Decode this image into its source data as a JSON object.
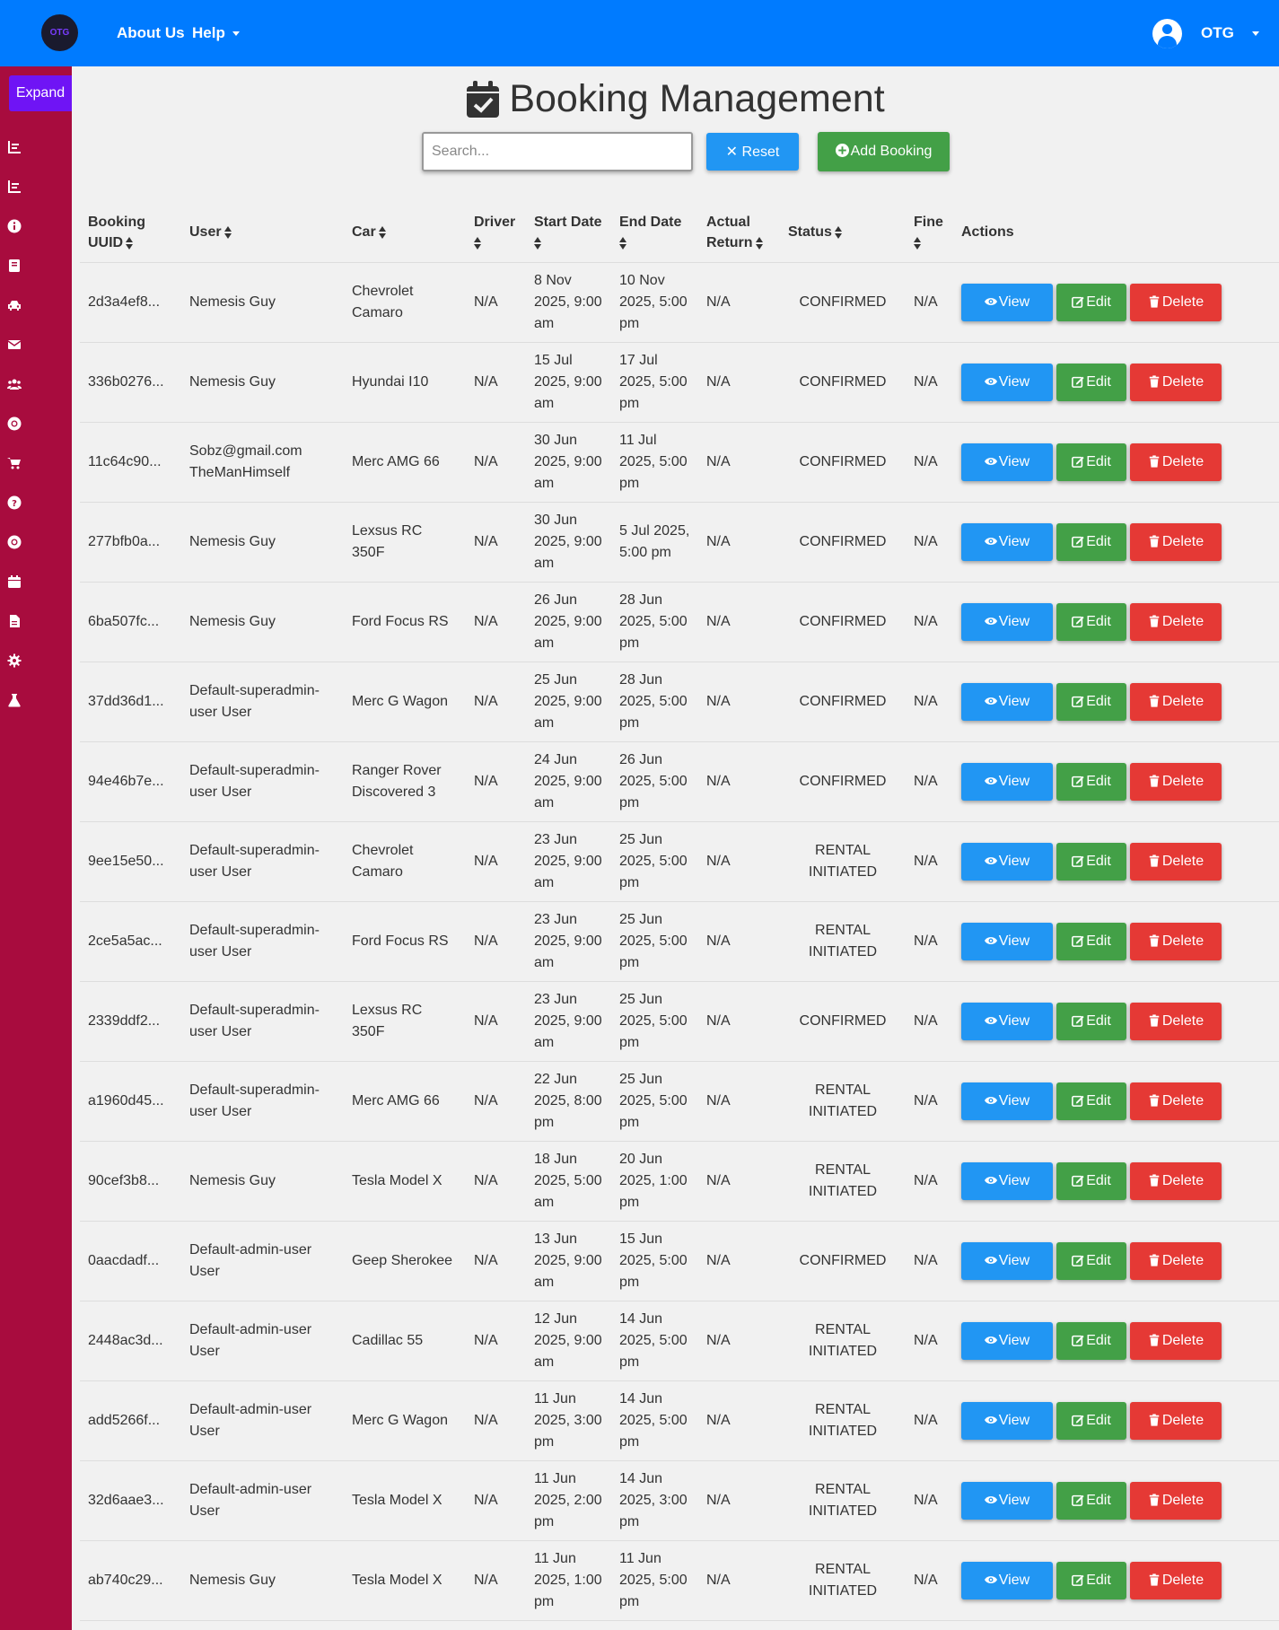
{
  "navbar": {
    "logo": "OTG",
    "about": "About Us",
    "help": "Help",
    "user": "OTG"
  },
  "sidebar": {
    "expand": "Expand",
    "icons": [
      "chart-bar-icon",
      "chart-bar-icon",
      "info-icon",
      "book-icon",
      "car-icon",
      "envelope-icon",
      "users-icon",
      "life-ring-icon",
      "cart-icon",
      "question-icon",
      "life-ring-icon",
      "calendar-icon",
      "file-icon",
      "gear-icon",
      "flask-icon"
    ]
  },
  "page": {
    "title": "Booking Management",
    "search_placeholder": "Search...",
    "reset": "✕ Reset",
    "add": "Add Booking"
  },
  "table": {
    "headers": {
      "uuid": "Booking UUID",
      "user": "User",
      "car": "Car",
      "driver": "Driver",
      "start": "Start Date",
      "end": "End Date",
      "actual": "Actual Return",
      "status": "Status",
      "fine": "Fine",
      "actions": "Actions"
    },
    "actions": {
      "view": "View",
      "edit": "Edit",
      "delete": "Delete"
    },
    "rows": [
      {
        "uuid": "2d3a4ef8...",
        "user": "Nemesis Guy",
        "car": "Chevrolet Camaro",
        "driver": "N/A",
        "start": "8 Nov 2025, 9:00 am",
        "end": "10 Nov 2025, 5:00 pm",
        "actual": "N/A",
        "status": "CONFIRMED",
        "fine": "N/A"
      },
      {
        "uuid": "336b0276...",
        "user": "Nemesis Guy",
        "car": "Hyundai I10",
        "driver": "N/A",
        "start": "15 Jul 2025, 9:00 am",
        "end": "17 Jul 2025, 5:00 pm",
        "actual": "N/A",
        "status": "CONFIRMED",
        "fine": "N/A"
      },
      {
        "uuid": "11c64c90...",
        "user": "Sobz@gmail.com TheManHimself",
        "car": "Merc AMG 66",
        "driver": "N/A",
        "start": "30 Jun 2025, 9:00 am",
        "end": "11 Jul 2025, 5:00 pm",
        "actual": "N/A",
        "status": "CONFIRMED",
        "fine": "N/A"
      },
      {
        "uuid": "277bfb0a...",
        "user": "Nemesis Guy",
        "car": "Lexsus RC 350F",
        "driver": "N/A",
        "start": "30 Jun 2025, 9:00 am",
        "end": "5 Jul 2025, 5:00 pm",
        "actual": "N/A",
        "status": "CONFIRMED",
        "fine": "N/A"
      },
      {
        "uuid": "6ba507fc...",
        "user": "Nemesis Guy",
        "car": "Ford Focus RS",
        "driver": "N/A",
        "start": "26 Jun 2025, 9:00 am",
        "end": "28 Jun 2025, 5:00 pm",
        "actual": "N/A",
        "status": "CONFIRMED",
        "fine": "N/A"
      },
      {
        "uuid": "37dd36d1...",
        "user": "Default-superadmin-user User",
        "car": "Merc G Wagon",
        "driver": "N/A",
        "start": "25 Jun 2025, 9:00 am",
        "end": "28 Jun 2025, 5:00 pm",
        "actual": "N/A",
        "status": "CONFIRMED",
        "fine": "N/A"
      },
      {
        "uuid": "94e46b7e...",
        "user": "Default-superadmin-user User",
        "car": "Ranger Rover Discovered 3",
        "driver": "N/A",
        "start": "24 Jun 2025, 9:00 am",
        "end": "26 Jun 2025, 5:00 pm",
        "actual": "N/A",
        "status": "CONFIRMED",
        "fine": "N/A"
      },
      {
        "uuid": "9ee15e50...",
        "user": "Default-superadmin-user User",
        "car": "Chevrolet Camaro",
        "driver": "N/A",
        "start": "23 Jun 2025, 9:00 am",
        "end": "25 Jun 2025, 5:00 pm",
        "actual": "N/A",
        "status": "RENTAL INITIATED",
        "fine": "N/A"
      },
      {
        "uuid": "2ce5a5ac...",
        "user": "Default-superadmin-user User",
        "car": "Ford Focus RS",
        "driver": "N/A",
        "start": "23 Jun 2025, 9:00 am",
        "end": "25 Jun 2025, 5:00 pm",
        "actual": "N/A",
        "status": "RENTAL INITIATED",
        "fine": "N/A"
      },
      {
        "uuid": "2339ddf2...",
        "user": "Default-superadmin-user User",
        "car": "Lexsus RC 350F",
        "driver": "N/A",
        "start": "23 Jun 2025, 9:00 am",
        "end": "25 Jun 2025, 5:00 pm",
        "actual": "N/A",
        "status": "CONFIRMED",
        "fine": "N/A"
      },
      {
        "uuid": "a1960d45...",
        "user": "Default-superadmin-user User",
        "car": "Merc AMG 66",
        "driver": "N/A",
        "start": "22 Jun 2025, 8:00 pm",
        "end": "25 Jun 2025, 5:00 pm",
        "actual": "N/A",
        "status": "RENTAL INITIATED",
        "fine": "N/A"
      },
      {
        "uuid": "90cef3b8...",
        "user": "Nemesis Guy",
        "car": "Tesla Model X",
        "driver": "N/A",
        "start": "18 Jun 2025, 5:00 am",
        "end": "20 Jun 2025, 1:00 pm",
        "actual": "N/A",
        "status": "RENTAL INITIATED",
        "fine": "N/A"
      },
      {
        "uuid": "0aacdadf...",
        "user": "Default-admin-user User",
        "car": "Geep Sherokee",
        "driver": "N/A",
        "start": "13 Jun 2025, 9:00 am",
        "end": "15 Jun 2025, 5:00 pm",
        "actual": "N/A",
        "status": "CONFIRMED",
        "fine": "N/A"
      },
      {
        "uuid": "2448ac3d...",
        "user": "Default-admin-user User",
        "car": "Cadillac 55",
        "driver": "N/A",
        "start": "12 Jun 2025, 9:00 am",
        "end": "14 Jun 2025, 5:00 pm",
        "actual": "N/A",
        "status": "RENTAL INITIATED",
        "fine": "N/A"
      },
      {
        "uuid": "add5266f...",
        "user": "Default-admin-user User",
        "car": "Merc G Wagon",
        "driver": "N/A",
        "start": "11 Jun 2025, 3:00 pm",
        "end": "14 Jun 2025, 5:00 pm",
        "actual": "N/A",
        "status": "RENTAL INITIATED",
        "fine": "N/A"
      },
      {
        "uuid": "32d6aae3...",
        "user": "Default-admin-user User",
        "car": "Tesla Model X",
        "driver": "N/A",
        "start": "11 Jun 2025, 2:00 pm",
        "end": "14 Jun 2025, 3:00 pm",
        "actual": "N/A",
        "status": "RENTAL INITIATED",
        "fine": "N/A"
      },
      {
        "uuid": "ab740c29...",
        "user": "Nemesis Guy",
        "car": "Tesla Model X",
        "driver": "N/A",
        "start": "11 Jun 2025, 1:00 pm",
        "end": "11 Jun 2025, 5:00 pm",
        "actual": "N/A",
        "status": "RENTAL INITIATED",
        "fine": "N/A"
      }
    ]
  }
}
